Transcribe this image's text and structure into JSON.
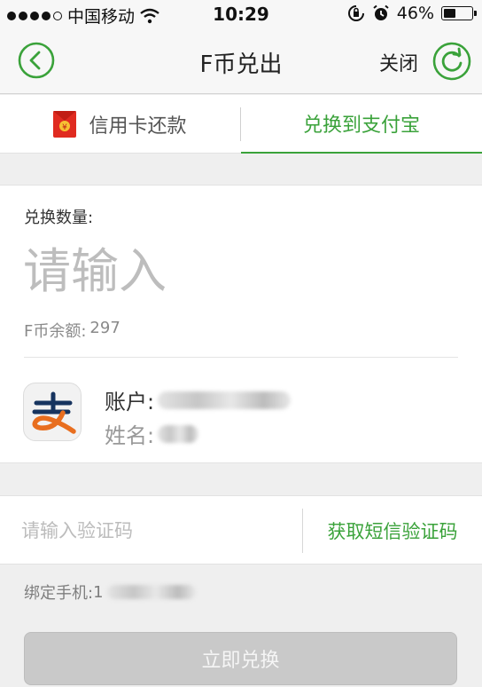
{
  "status_bar": {
    "carrier": "中国移动",
    "time": "10:29",
    "battery": "46%",
    "battery_level": 0.46,
    "icons": [
      "signal-dots-icon",
      "wifi-icon",
      "rotation-lock-icon",
      "alarm-icon",
      "battery-icon"
    ]
  },
  "nav": {
    "title": "F币兑出",
    "close_label": "关闭",
    "icons": [
      "back-circle-icon",
      "refresh-circle-icon"
    ],
    "accent": "#3aa23a"
  },
  "tabs": [
    {
      "label": "信用卡还款",
      "icon": "red-packet-icon",
      "active": false
    },
    {
      "label": "兑换到支付宝",
      "active": true
    }
  ],
  "form": {
    "amount_label": "兑换数量:",
    "amount_placeholder": "请输入",
    "balance_label": "F币余额:",
    "balance_value": "297",
    "account_label": "账户:",
    "name_label": "姓名:",
    "alipay_logo_icon": "alipay-logo-icon",
    "verify_placeholder": "请输入验证码",
    "get_code_label": "获取短信验证码",
    "phone_label": "绑定手机:",
    "phone_value": "1",
    "submit_label": "立即兑换"
  }
}
